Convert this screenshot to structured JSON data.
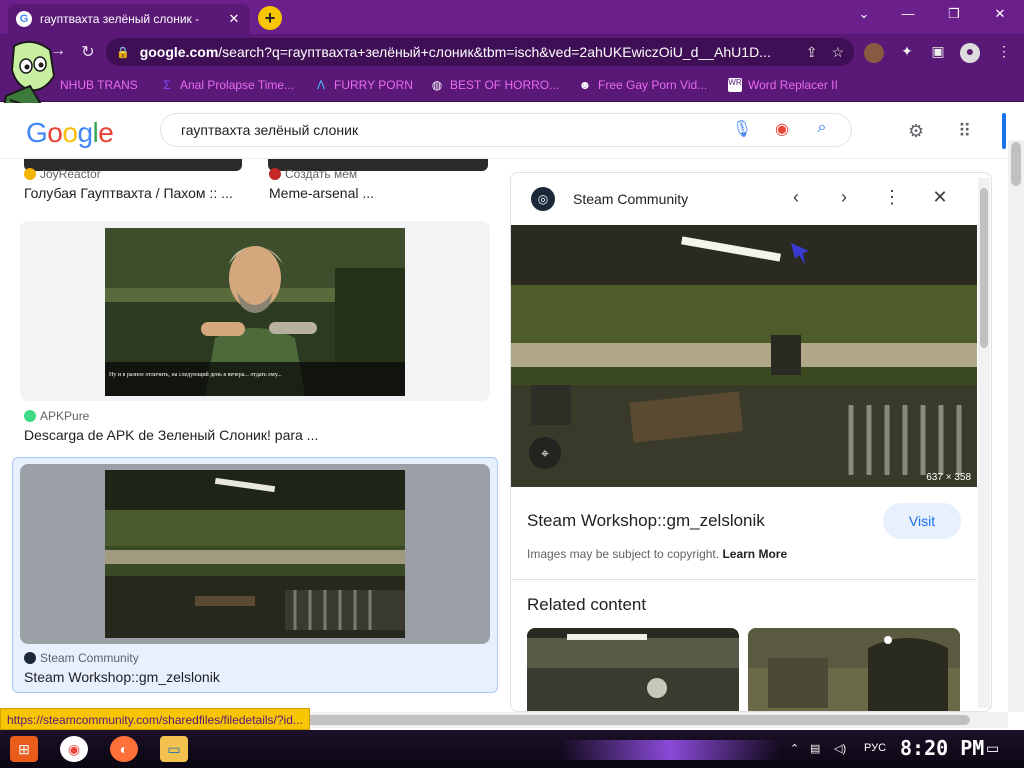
{
  "browser": {
    "tab_title": "гауптвахта зелёный слоник -",
    "tab_close": "✕",
    "new_tab": "+",
    "url_host": "google.com",
    "url_rest": "/search?q=гауптвахта+зелёный+слоник&tbm=isch&ved=2ahUKEwiczOiU_d__AhU1D...",
    "window_controls": [
      "⌄",
      "—",
      "❐",
      "✕"
    ]
  },
  "bookmarks": [
    {
      "label": "NHUB TRANS",
      "icon": "bookmark-icon"
    },
    {
      "label": "Anal Prolapse Time...",
      "icon": "sigma-icon"
    },
    {
      "label": "FURRY PORN",
      "icon": "lambda-icon"
    },
    {
      "label": "BEST OF HORRO...",
      "icon": "globe-icon"
    },
    {
      "label": "Free Gay Porn Vid...",
      "icon": "ghost-icon"
    },
    {
      "label": "Word Replacer II",
      "icon": "wr-icon"
    }
  ],
  "google": {
    "logo_letters": [
      "G",
      "o",
      "o",
      "g",
      "l",
      "e"
    ],
    "logo_colors": [
      "#4285f4",
      "#ea4335",
      "#fbbc05",
      "#4285f4",
      "#34a853",
      "#ea4335"
    ],
    "query": "гауптвахта зелёный слоник"
  },
  "results": [
    {
      "source": "JoyReactor",
      "title": "Голубая Гауптвахта / Пахом :: ..."
    },
    {
      "source": "Создать мем",
      "title": "Meme-arsenal ..."
    },
    {
      "source": "APKPure",
      "title": "Descarga de APK de Зеленый Слоник! para ..."
    },
    {
      "source": "Steam Community",
      "title": "Steam Workshop::gm_zelslonik"
    }
  ],
  "apk_caption": "Ну и в разное отличить, на следующий день в вечера... отдать ему...",
  "preview": {
    "site": "Steam Community",
    "dimensions": "637 × 358",
    "title": "Steam Workshop::gm_zelslonik",
    "visit": "Visit",
    "copyright": "Images may be subject to copyright.",
    "learn_more": "Learn More",
    "related": "Related content"
  },
  "status_url": "https://steamcommunity.com/sharedfiles/filedetails/?id...",
  "taskbar": {
    "lang": "РУС",
    "clock": "8:20 PM"
  }
}
